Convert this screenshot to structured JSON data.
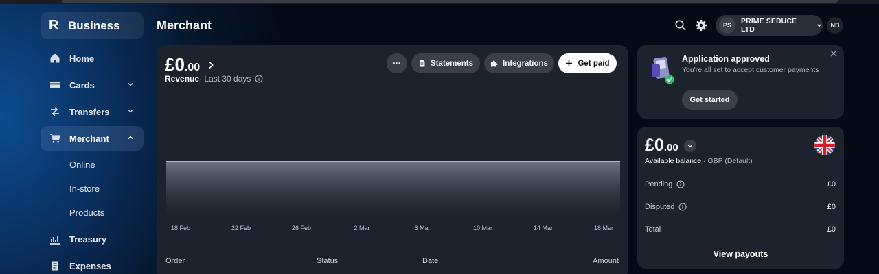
{
  "brand": {
    "logo": "R",
    "name": "Business"
  },
  "sidebar": {
    "items": [
      {
        "label": "Home",
        "icon": "home-icon"
      },
      {
        "label": "Cards",
        "icon": "card-icon",
        "chevron": "down"
      },
      {
        "label": "Transfers",
        "icon": "transfer-icon",
        "chevron": "down"
      },
      {
        "label": "Merchant",
        "icon": "cart-icon",
        "chevron": "up",
        "active": true
      },
      {
        "label": "Treasury",
        "icon": "chart-icon"
      },
      {
        "label": "Expenses",
        "icon": "receipt-icon"
      }
    ],
    "merchant_sub": [
      "Online",
      "In-store",
      "Products"
    ]
  },
  "header": {
    "title": "Merchant",
    "account": {
      "initials": "PS",
      "name": "PRIME SEDUCE LTD"
    },
    "user_initials": "NB"
  },
  "revenue": {
    "amount_major": "£0",
    "amount_minor": ".00",
    "label": "Revenue",
    "period": " · Last 30 days",
    "buttons": {
      "more": "···",
      "statements": "Statements",
      "integrations": "Integrations",
      "get_paid": "Get paid"
    }
  },
  "table": {
    "headers": [
      "Order",
      "Status",
      "Date",
      "Amount"
    ]
  },
  "chart_data": {
    "type": "area",
    "x": [
      "18 Feb",
      "22 Feb",
      "26 Feb",
      "2 Mar",
      "6 Mar",
      "10 Mar",
      "14 Mar",
      "18 Mar"
    ],
    "series": [
      {
        "values": [
          0,
          0,
          0,
          0,
          0,
          0,
          0,
          0
        ]
      }
    ],
    "xlabel": "",
    "ylabel": "",
    "grid": false
  },
  "approved": {
    "title": "Application approved",
    "description": "You're all set to accept customer payments",
    "cta": "Get started"
  },
  "balance": {
    "amount_major": "£0",
    "amount_minor": ".00",
    "label": "Available balance",
    "currency": " · GBP (Default)",
    "rows": [
      {
        "label": "Pending",
        "value": "£0",
        "info": true
      },
      {
        "label": "Disputed",
        "value": "£0",
        "info": true
      },
      {
        "label": "Total",
        "value": "£0",
        "info": false
      }
    ],
    "view_payouts": "View payouts"
  },
  "colors": {
    "accent": "#0d4c8f",
    "card": "#1c232d",
    "button": "#3a404a",
    "success": "#2fbf71"
  }
}
